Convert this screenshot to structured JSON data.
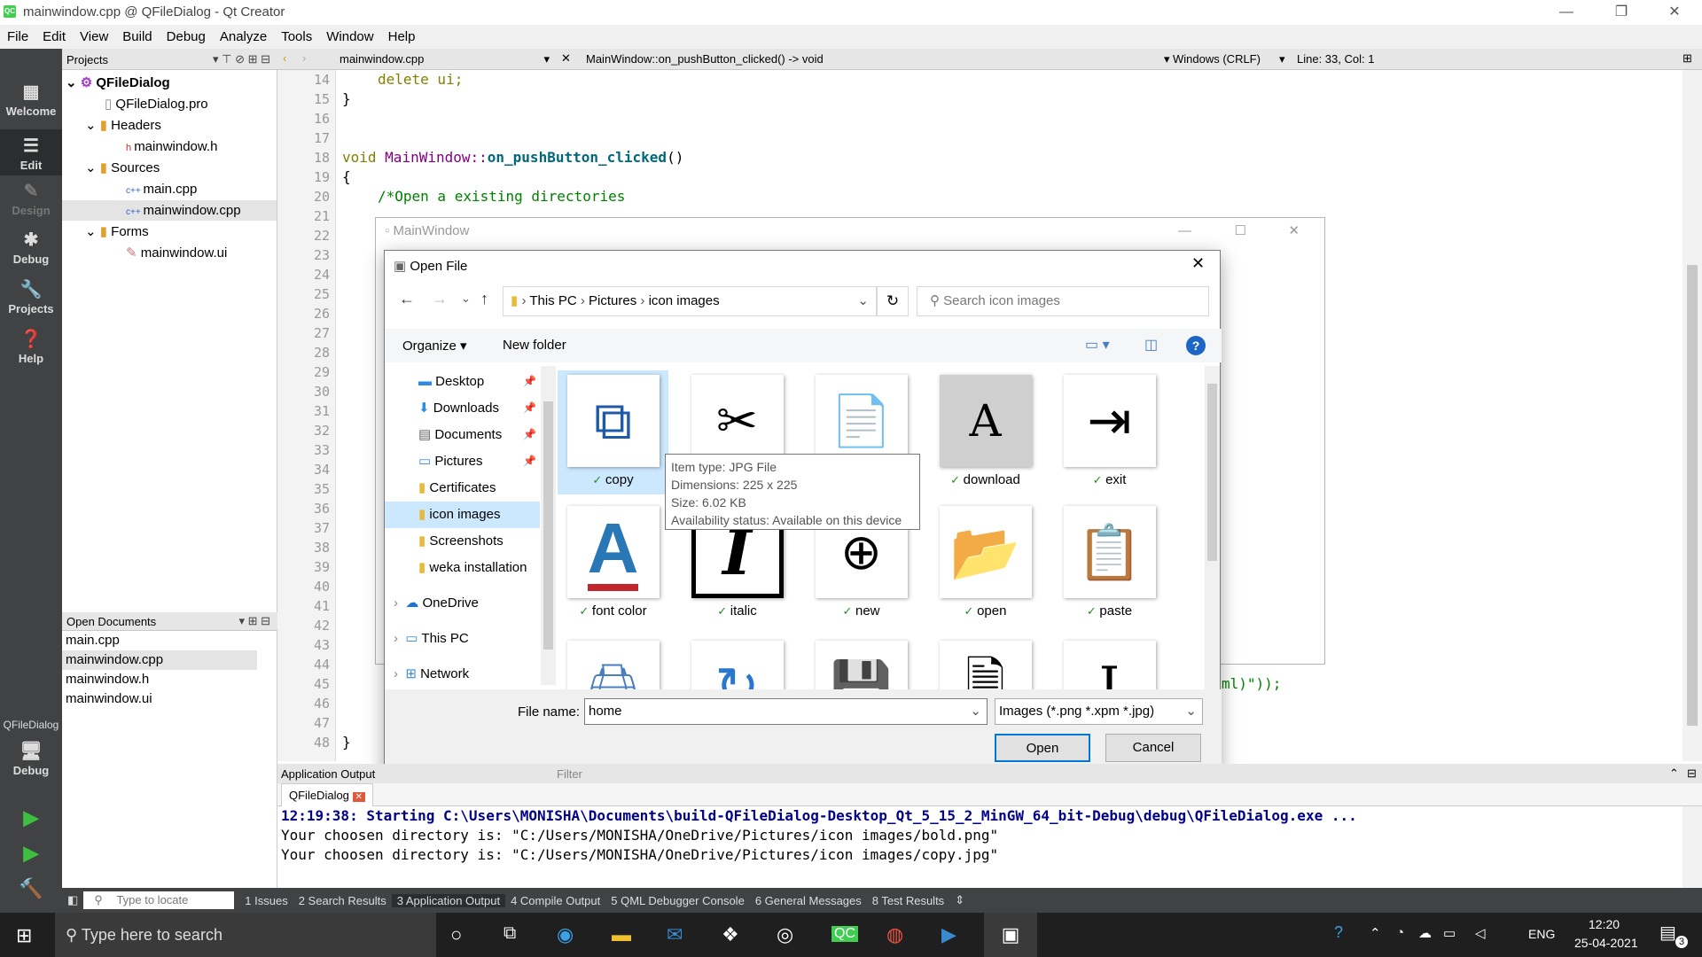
{
  "window": {
    "title": "mainwindow.cpp @ QFileDialog - Qt Creator"
  },
  "menu": [
    "File",
    "Edit",
    "View",
    "Build",
    "Debug",
    "Analyze",
    "Tools",
    "Window",
    "Help"
  ],
  "modes": [
    {
      "label": "Welcome",
      "icon": "grid-icon"
    },
    {
      "label": "Edit",
      "icon": "edit-icon"
    },
    {
      "label": "Design",
      "icon": "pencil-icon"
    },
    {
      "label": "Debug",
      "icon": "bug-icon"
    },
    {
      "label": "Projects",
      "icon": "wrench-icon"
    },
    {
      "label": "Help",
      "icon": "help-icon"
    }
  ],
  "kit": {
    "project": "QFileDialog",
    "mode": "Debug"
  },
  "projects": {
    "header": "Projects",
    "root": "QFileDialog",
    "pro": "QFileDialog.pro",
    "headers": "Headers",
    "mainwindow_h": "mainwindow.h",
    "sources": "Sources",
    "main_cpp": "main.cpp",
    "mainwindow_cpp": "mainwindow.cpp",
    "forms": "Forms",
    "mainwindow_ui": "mainwindow.ui"
  },
  "open_documents": {
    "header": "Open Documents",
    "items": [
      "main.cpp",
      "mainwindow.cpp",
      "mainwindow.h",
      "mainwindow.ui"
    ]
  },
  "editor": {
    "file": "mainwindow.cpp",
    "symbol": "MainWindow::on_pushButton_clicked() -> void",
    "line_ending": "Windows (CRLF)",
    "position": "Line: 33, Col: 1",
    "line_numbers": [
      "14",
      "15",
      "16",
      "17",
      "18",
      "19",
      "20",
      "21",
      "22",
      "23",
      "24",
      "25",
      "26",
      "27",
      "28",
      "29",
      "30",
      "31",
      "32",
      "33",
      "34",
      "35",
      "36",
      "37",
      "38",
      "39",
      "40",
      "41",
      "42",
      "43",
      "44",
      "45",
      "46",
      "47",
      "48"
    ],
    "code_l14": "delete ui;",
    "code_l15": "}",
    "code_l18a": "void ",
    "code_l18b": "MainWindow::",
    "code_l18c": "on_pushButton_clicked",
    "code_l18d": "()",
    "code_l19": "{",
    "code_l20": "/*Open a existing directories",
    "code_l45": "ml)\"));",
    "code_l48": "}"
  },
  "app_output": {
    "header": "Application Output",
    "tab": "QFileDialog",
    "filter_placeholder": "Filter",
    "lines": [
      "12:19:38: Starting C:\\Users\\MONISHA\\Documents\\build-QFileDialog-Desktop_Qt_5_15_2_MinGW_64_bit-Debug\\debug\\QFileDialog.exe ...",
      "Your choosen directory is: \"C:/Users/MONISHA/OneDrive/Pictures/icon images/bold.png\"",
      "Your choosen directory is: \"C:/Users/MONISHA/OneDrive/Pictures/icon images/copy.jpg\""
    ]
  },
  "bottom_tabs": [
    "1 Issues",
    "2 Search Results",
    "3 Application Output",
    "4 Compile Output",
    "5 QML Debugger Console",
    "6 General Messages",
    "8 Test Results"
  ],
  "locator_placeholder": "Type to locate (Ctrl+...",
  "main_window": {
    "title": "MainWindow"
  },
  "dialog": {
    "title": "Open File",
    "breadcrumb": [
      "This PC",
      "Pictures",
      "icon images"
    ],
    "search_placeholder": "Search icon images",
    "organize": "Organize",
    "new_folder": "New folder",
    "nav": [
      "Desktop",
      "Downloads",
      "Documents",
      "Pictures",
      "Certificates",
      "icon images",
      "Screenshots",
      "weka installation",
      "OneDrive",
      "This PC",
      "Network"
    ],
    "files": [
      "copy",
      "download",
      "exit",
      "font color",
      "italic",
      "new",
      "open",
      "paste"
    ],
    "tooltip": [
      "Item type: JPG File",
      "Dimensions: 225 x 225",
      "Size: 6.02 KB",
      "Availability status: Available on this device"
    ],
    "filename_label": "File name:",
    "filename_value": "home",
    "filter": "Images (*.png *.xpm *.jpg)",
    "open_button": "Open",
    "cancel_button": "Cancel"
  },
  "taskbar": {
    "search_placeholder": "Type here to search",
    "lang": "ENG",
    "time": "12:20",
    "date": "25-04-2021",
    "notifications": "3"
  }
}
